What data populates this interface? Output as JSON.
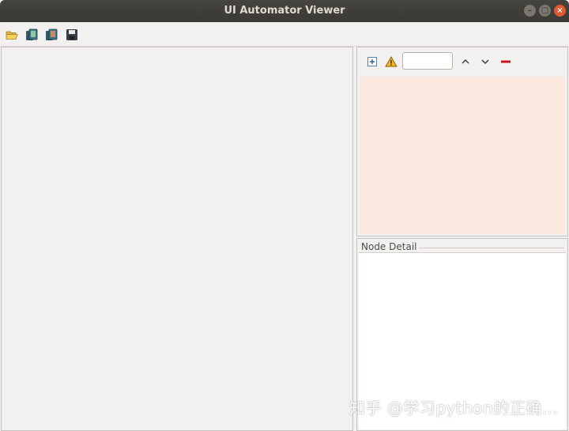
{
  "window": {
    "title": "UI Automator Viewer",
    "buttons": {
      "minimize": "–",
      "maximize": "□",
      "close": "×"
    }
  },
  "toolbar": {
    "items": [
      {
        "icon": "open-folder-icon"
      },
      {
        "icon": "device-screenshot-icon"
      },
      {
        "icon": "device-screenshot-compressed-icon"
      },
      {
        "icon": "save-icon"
      }
    ]
  },
  "tree_toolbar": {
    "filter": {
      "value": "",
      "placeholder": ""
    },
    "icons": [
      "expand-all-icon",
      "warning-icon",
      "chevron-up-icon",
      "chevron-down-icon",
      "clear-filter-icon"
    ]
  },
  "node_detail": {
    "label": "Node Detail"
  },
  "watermark": {
    "text": "知乎 @学习python的正确..."
  },
  "colors": {
    "tree_bg": "#fbe8df",
    "title_bar": "#3f3e3a",
    "close_btn": "#e2582f"
  }
}
